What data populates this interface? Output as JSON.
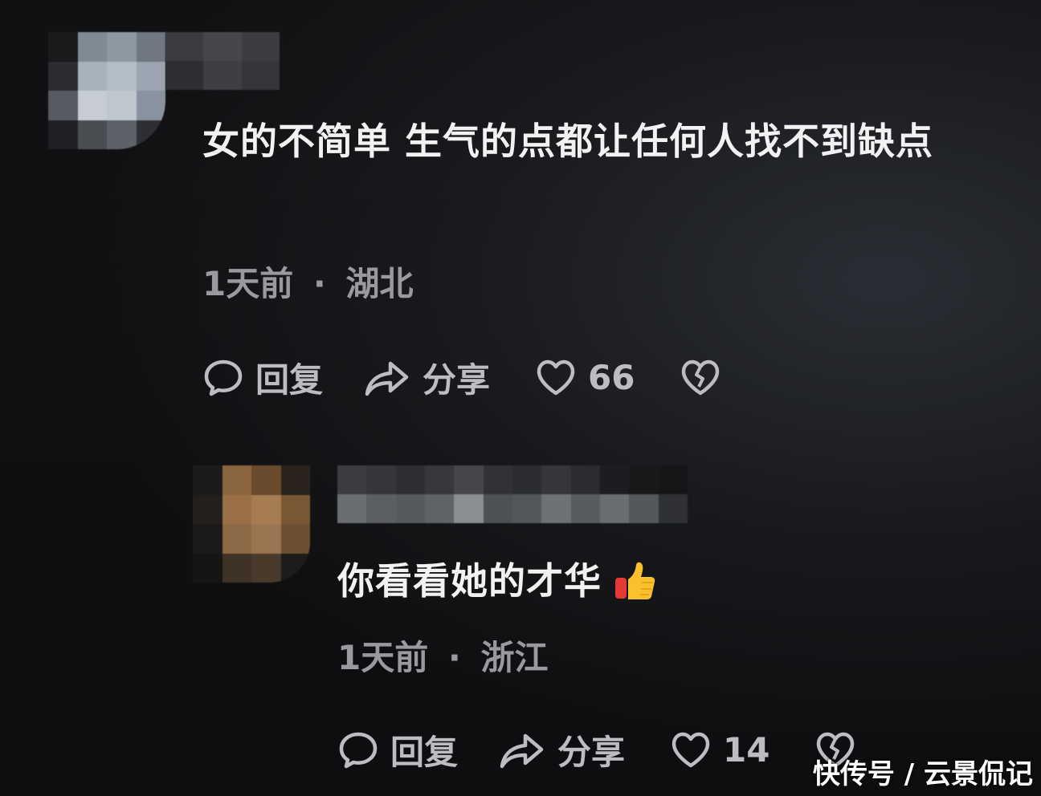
{
  "comments": [
    {
      "text": "女的不简单 生气的点都让任何人找不到缺点",
      "time": "1天前",
      "separator": "·",
      "location": "湖北",
      "reply_label": "回复",
      "share_label": "分享",
      "likes": "66"
    },
    {
      "text": "你看看她的才华",
      "emoji": "thumbs-up-emoji",
      "time": "1天前",
      "separator": "·",
      "location": "浙江",
      "reply_label": "回复",
      "share_label": "分享",
      "likes": "14"
    }
  ],
  "watermark": "快传号 / 云景侃记",
  "icons": {
    "reply": "comment-bubble-icon",
    "share": "share-arrow-icon",
    "like": "heart-icon",
    "dislike": "broken-heart-icon"
  },
  "colors": {
    "background": "#0c0c0e",
    "text": "#f2f2f2",
    "meta": "#9a9a9e",
    "actions": "#bdbdc1"
  }
}
